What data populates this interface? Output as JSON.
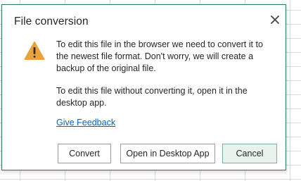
{
  "dialog": {
    "title": "File conversion",
    "close_icon": "close-icon",
    "warning_icon": "warning-triangle-icon",
    "message_1": "To edit this file in the browser we need to convert it to the newest file format. Don't worry, we will create a backup of the original file.",
    "message_2": "To edit this file without converting it, open it in the desktop app.",
    "feedback_link": "Give Feedback",
    "buttons": {
      "convert": "Convert",
      "open_desktop": "Open in Desktop App",
      "cancel": "Cancel"
    }
  },
  "colors": {
    "accent_border": "#2e7d4f",
    "warning": "#e8a33d",
    "link": "#0563c1",
    "cancel_bg": "#e7f3ec"
  }
}
